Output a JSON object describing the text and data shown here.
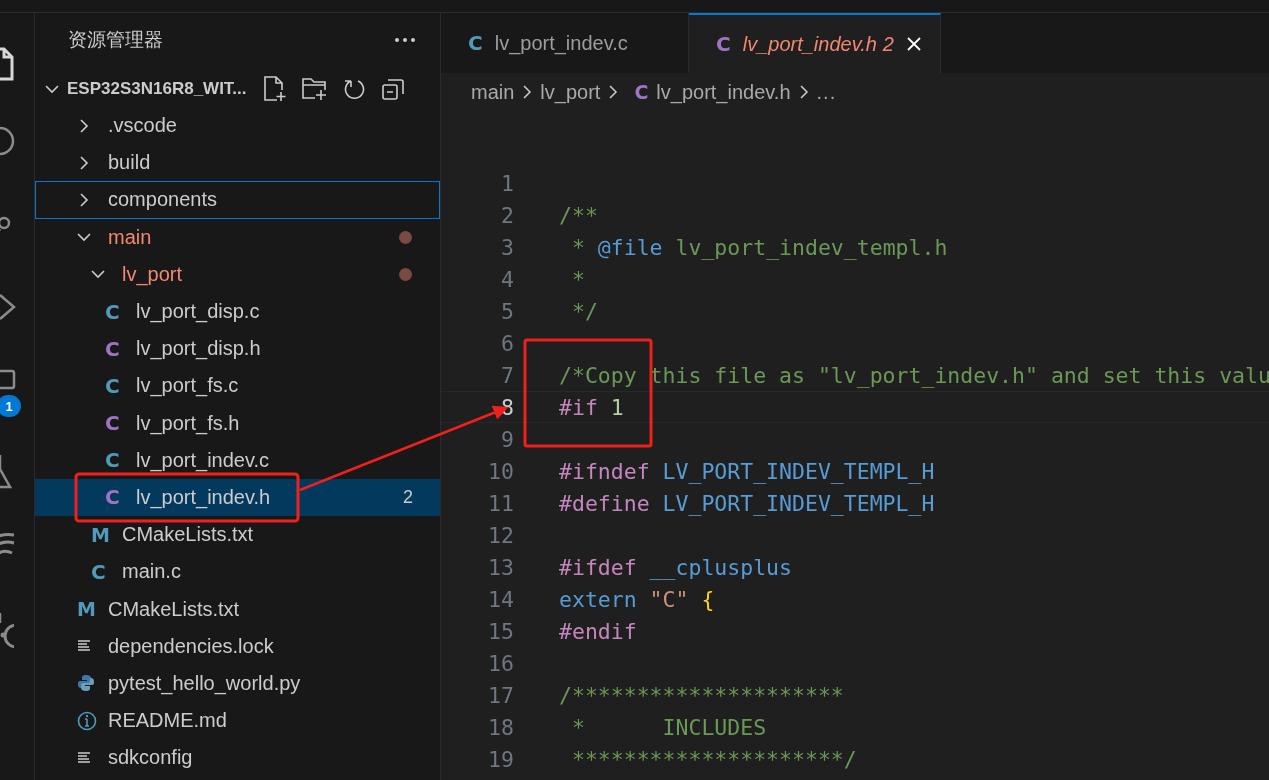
{
  "activity_bar": {
    "extensions_badge": "1"
  },
  "sidebar": {
    "title": "资源管理器",
    "root": {
      "label": "ESP32S3N16R8_WIT...",
      "expanded": true,
      "children": [
        {
          "kind": "folder",
          "label": ".vscode",
          "expanded": false,
          "modified": false,
          "selected": false,
          "focused": false
        },
        {
          "kind": "folder",
          "label": "build",
          "expanded": false,
          "modified": false,
          "selected": false,
          "focused": false
        },
        {
          "kind": "folder",
          "label": "components",
          "expanded": false,
          "modified": false,
          "selected": false,
          "focused": true
        },
        {
          "kind": "folder",
          "label": "main",
          "expanded": true,
          "modified": true,
          "selected": false,
          "focused": false,
          "children": [
            {
              "kind": "folder",
              "label": "lv_port",
              "expanded": true,
              "modified": true,
              "selected": false,
              "focused": false,
              "children": [
                {
                  "kind": "c-file",
                  "glyph": "C",
                  "label": "lv_port_disp.c",
                  "selected": false,
                  "focused": false
                },
                {
                  "kind": "h-file",
                  "glyph": "C",
                  "label": "lv_port_disp.h",
                  "selected": false,
                  "focused": false
                },
                {
                  "kind": "c-file",
                  "glyph": "C",
                  "label": "lv_port_fs.c",
                  "selected": false,
                  "focused": false
                },
                {
                  "kind": "h-file",
                  "glyph": "C",
                  "label": "lv_port_fs.h",
                  "selected": false,
                  "focused": false
                },
                {
                  "kind": "c-file",
                  "glyph": "C",
                  "label": "lv_port_indev.c",
                  "selected": false,
                  "focused": false
                },
                {
                  "kind": "h-file",
                  "glyph": "C",
                  "label": "lv_port_indev.h",
                  "selected": true,
                  "focused": false,
                  "problems": "2"
                }
              ]
            },
            {
              "kind": "cmake",
              "glyph": "M",
              "label": "CMakeLists.txt",
              "selected": false,
              "focused": false
            },
            {
              "kind": "c-file",
              "glyph": "C",
              "label": "main.c",
              "selected": false,
              "focused": false
            }
          ]
        },
        {
          "kind": "cmake",
          "glyph": "M",
          "label": "CMakeLists.txt",
          "selected": false,
          "focused": false
        },
        {
          "kind": "text",
          "label": "dependencies.lock",
          "selected": false,
          "focused": false
        },
        {
          "kind": "python",
          "label": "pytest_hello_world.py",
          "selected": false,
          "focused": false
        },
        {
          "kind": "info",
          "label": "README.md",
          "selected": false,
          "focused": false
        },
        {
          "kind": "text",
          "label": "sdkconfig",
          "selected": false,
          "focused": false
        }
      ]
    }
  },
  "tabs": [
    {
      "kind": "c-file",
      "glyph": "C",
      "label": "lv_port_indev.c",
      "selected": false,
      "preview": false
    },
    {
      "kind": "h-file",
      "glyph": "C",
      "label": "lv_port_indev.h",
      "selected": true,
      "preview": true,
      "problems": "2"
    }
  ],
  "breadcrumb": [
    {
      "kind": "folder",
      "label": "main"
    },
    {
      "kind": "folder",
      "label": "lv_port"
    },
    {
      "kind": "h-file",
      "glyph": "C",
      "label": "lv_port_indev.h"
    },
    {
      "kind": "more",
      "label": "..."
    }
  ],
  "editor": {
    "lines": [
      {
        "number": "1",
        "current": false
      },
      {
        "number": "2",
        "current": false,
        "tokens": [
          {
            "kind": "comment",
            "text": "/**"
          }
        ]
      },
      {
        "number": "3",
        "current": false,
        "tokens": [
          {
            "kind": "comment",
            "text": " * "
          },
          {
            "kind": "doctag",
            "text": "@file"
          },
          {
            "kind": "comment",
            "text": " lv_port_indev_templ.h"
          }
        ]
      },
      {
        "number": "4",
        "current": false,
        "tokens": [
          {
            "kind": "comment",
            "text": " *"
          }
        ]
      },
      {
        "number": "5",
        "current": false,
        "tokens": [
          {
            "kind": "comment",
            "text": " */"
          }
        ]
      },
      {
        "number": "6",
        "current": false
      },
      {
        "number": "7",
        "current": false,
        "tokens": [
          {
            "kind": "comment",
            "text": "/*Copy this file as \"lv_port_indev.h\" and set this valu"
          }
        ]
      },
      {
        "number": "8",
        "current": true,
        "tokens": [
          {
            "kind": "preprocessor",
            "text": "#if"
          },
          {
            "kind": "number",
            "text": " 1"
          }
        ]
      },
      {
        "number": "9",
        "current": false
      },
      {
        "number": "10",
        "current": false,
        "tokens": [
          {
            "kind": "preprocessor",
            "text": "#ifndef"
          },
          {
            "kind": "macro",
            "text": " LV_PORT_INDEV_TEMPL_H"
          }
        ]
      },
      {
        "number": "11",
        "current": false,
        "tokens": [
          {
            "kind": "preprocessor",
            "text": "#define"
          },
          {
            "kind": "macro",
            "text": " LV_PORT_INDEV_TEMPL_H"
          }
        ]
      },
      {
        "number": "12",
        "current": false
      },
      {
        "number": "13",
        "current": false,
        "tokens": [
          {
            "kind": "preprocessor",
            "text": "#ifdef"
          },
          {
            "kind": "macro",
            "text": " __cplusplus"
          }
        ]
      },
      {
        "number": "14",
        "current": false,
        "tokens": [
          {
            "kind": "keyword",
            "text": "extern"
          },
          {
            "kind": "string",
            "text": " \"C\""
          },
          {
            "kind": "brace",
            "text": " {"
          }
        ]
      },
      {
        "number": "15",
        "current": false,
        "tokens": [
          {
            "kind": "preprocessor",
            "text": "#endif"
          }
        ]
      },
      {
        "number": "16",
        "current": false
      },
      {
        "number": "17",
        "current": false,
        "tokens": [
          {
            "kind": "comment",
            "text": "/*********************"
          }
        ]
      },
      {
        "number": "18",
        "current": false,
        "tokens": [
          {
            "kind": "comment",
            "text": " *      INCLUDES"
          }
        ]
      },
      {
        "number": "19",
        "current": false,
        "tokens": [
          {
            "kind": "comment",
            "text": " *********************/"
          }
        ]
      }
    ]
  }
}
